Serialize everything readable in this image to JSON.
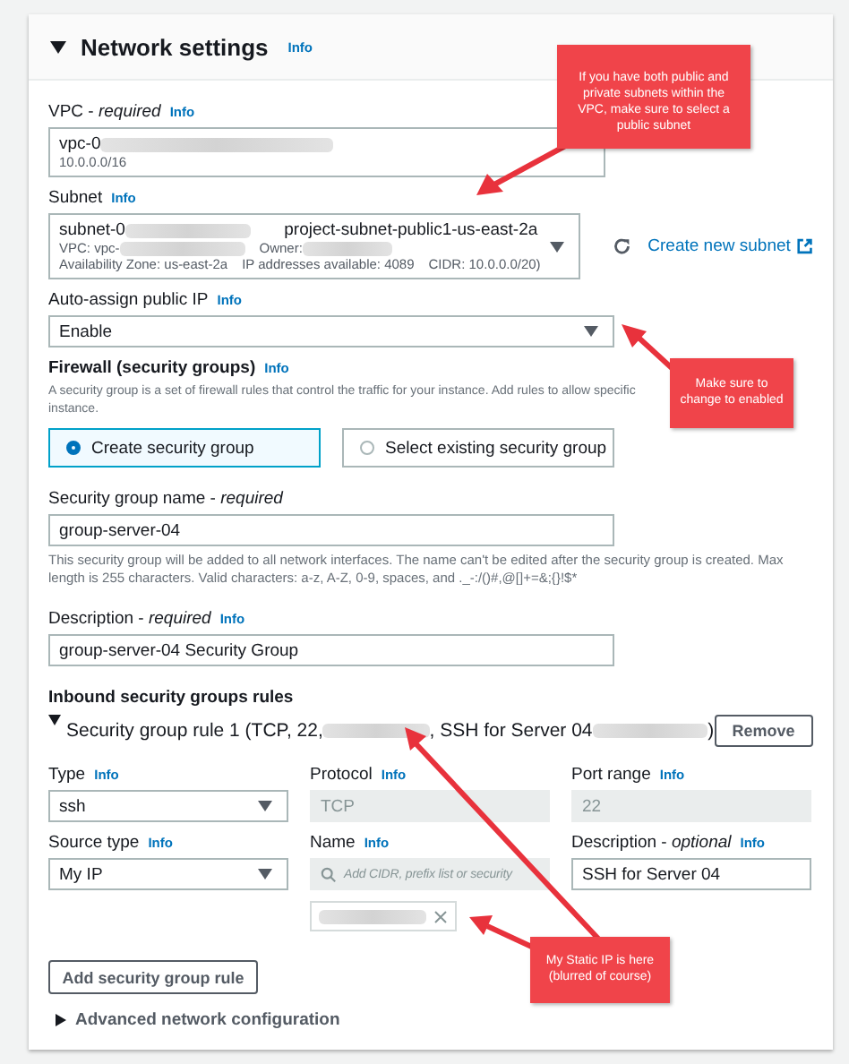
{
  "section": {
    "title": "Network settings",
    "info": "Info",
    "expanded": true
  },
  "vpc": {
    "label": "VPC - *required*",
    "info": "Info",
    "value": "vpc-0",
    "detail": "10.0.0.0/16"
  },
  "subnet": {
    "label": "Subnet",
    "info": "Info",
    "value": "subnet-0",
    "name": "project-subnet-public1-us-east-2a",
    "vpc": "VPC: vpc-",
    "owner": "Owner:",
    "zone": "Availability Zone: us-east-2a",
    "ips": "IP addresses available: 4089",
    "cidr": "CIDR: 10.0.0.0/20)",
    "create_link": "Create new subnet"
  },
  "auto_ip": {
    "label": "Auto-assign public IP",
    "info": "Info",
    "value": "Enable"
  },
  "firewall": {
    "label": "Firewall (security groups)",
    "info": "Info",
    "description_lines": [
      "A security group is a set of firewall rules that control the traffic for your instance. Add rules to allow specific",
      "instance."
    ],
    "options": [
      {
        "label": "Create security group",
        "selected": true
      },
      {
        "label": "Select existing security group",
        "selected": false
      }
    ]
  },
  "group_name": {
    "label": "Security group name - *required*",
    "value": "group-server-04",
    "hint": "This security group will be added to all network interfaces. The name can't be edited after the security group is created. Max length is 255 characters. Valid characters: a-z, A-Z, 0-9, spaces, and ._-:/()#,@[]+=&;{}!$*"
  },
  "group_description": {
    "label": "Description - *required*",
    "info": "Info",
    "value": "group-server-04 Security Group"
  },
  "inbound": {
    "title": "Inbound security groups rules",
    "rule": {
      "expanded": true,
      "title_parts": [
        "Security group rule 1 (TCP, 22,",
        ", SSH for Server 04",
        ")"
      ],
      "remove": "Remove",
      "fields": [
        {
          "kind": "select",
          "label": "Type",
          "info": "Info",
          "value": "ssh"
        },
        {
          "kind": "readonly",
          "label": "Protocol",
          "info": "Info",
          "value": "TCP"
        },
        {
          "kind": "readonly",
          "label": "Port range",
          "info": "Info",
          "value": "22"
        },
        {
          "kind": "select",
          "label": "Source type",
          "info": "Info",
          "value": "My IP"
        },
        {
          "kind": "search",
          "label": "Name",
          "info": "Info",
          "placeholder": "Add CIDR, prefix list or security"
        },
        {
          "kind": "text",
          "label": "Description - *optional*",
          "info": "Info",
          "value": "SSH for Server 04"
        }
      ]
    },
    "add_button": "Add security group rule"
  },
  "advanced": {
    "label": "Advanced network configuration",
    "expanded": false
  },
  "annotations": [
    {
      "text": "If you have both public and private subnets within the VPC, make sure to select a public subnet"
    },
    {
      "text": "Make sure to change to enabled"
    },
    {
      "text": "My Static IP is here (blurred of course)"
    }
  ]
}
